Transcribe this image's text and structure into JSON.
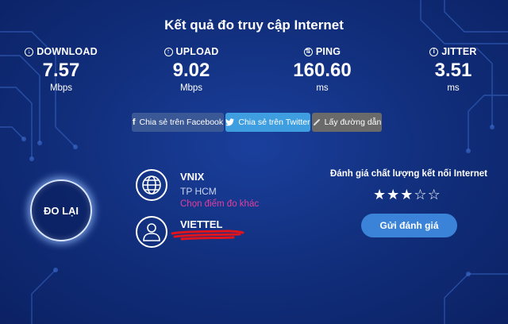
{
  "header": {
    "title": "Kết quả đo truy cập Internet"
  },
  "stats": [
    {
      "label": "DOWNLOAD",
      "value": "7.57",
      "unit": "Mbps",
      "icon": "download-icon"
    },
    {
      "label": "UPLOAD",
      "value": "9.02",
      "unit": "Mbps",
      "icon": "upload-icon"
    },
    {
      "label": "PING",
      "value": "160.60",
      "unit": "ms",
      "icon": "ping-icon"
    },
    {
      "label": "JITTER",
      "value": "3.51",
      "unit": "ms",
      "icon": "info-icon"
    }
  ],
  "share": {
    "facebook": "Chia sẻ trên Facebook",
    "twitter": "Chia sẻ trên Twitter",
    "link": "Lấy đường dẫn"
  },
  "redo_label": "ĐO LẠI",
  "server": {
    "name": "VNIX",
    "city": "TP HCM",
    "change": "Chọn điểm đo khác"
  },
  "client": {
    "isp": "VIETTEL"
  },
  "rating": {
    "title": "Đánh giá chất lượng kết nối Internet",
    "stars": 3,
    "max": 5,
    "button": "Gửi đánh giá"
  },
  "colors": {
    "background": "#12307f",
    "facebook": "#3a5796",
    "twitter": "#3f9ee0",
    "link": "#6a6a6a",
    "accent_pink": "#e0409f",
    "rate_button": "#3b83d8",
    "redaction": "#e0141c"
  }
}
